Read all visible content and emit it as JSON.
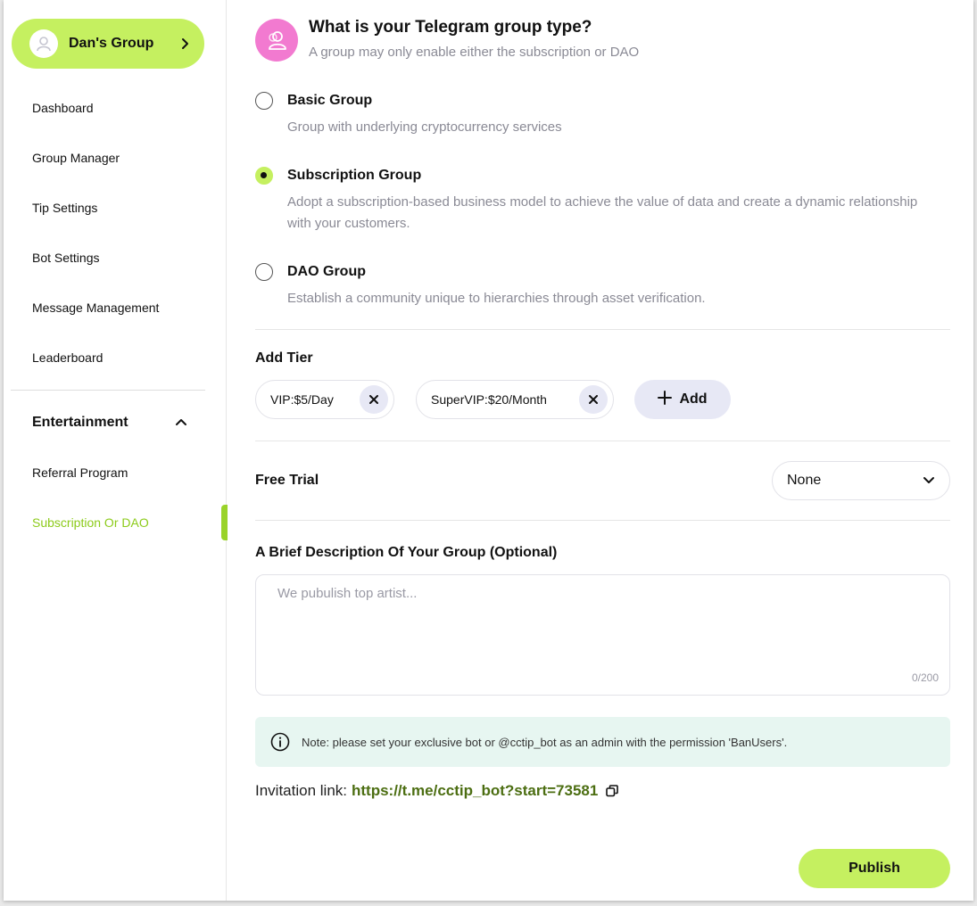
{
  "sidebar": {
    "group_name": "Dan's Group",
    "items": [
      {
        "label": "Dashboard"
      },
      {
        "label": "Group Manager"
      },
      {
        "label": "Tip Settings"
      },
      {
        "label": "Bot Settings"
      },
      {
        "label": "Message Management"
      },
      {
        "label": "Leaderboard"
      }
    ],
    "section": {
      "label": "Entertainment",
      "expanded": true,
      "items": [
        {
          "label": "Referral Program",
          "active": false
        },
        {
          "label": "Subscription Or DAO",
          "active": true
        }
      ]
    }
  },
  "main": {
    "title": "What is your Telegram group type?",
    "subtitle": "A group may only enable either the subscription or DAO",
    "options": [
      {
        "title": "Basic Group",
        "desc": "Group with underlying cryptocurrency services",
        "checked": false
      },
      {
        "title": "Subscription Group",
        "desc": "Adopt a subscription-based business model to achieve the value of data and create a dynamic relationship with your customers.",
        "checked": true
      },
      {
        "title": "DAO Group",
        "desc": "Establish a community unique to hierarchies through asset verification.",
        "checked": false
      }
    ],
    "tier": {
      "label": "Add Tier",
      "chips": [
        "VIP:$5/Day",
        "SuperVIP:$20/Month"
      ],
      "add_label": "Add"
    },
    "free_trial": {
      "label": "Free Trial",
      "value": "None"
    },
    "description": {
      "label": "A Brief Description Of Your Group (Optional)",
      "placeholder": "We pubulish top artist...",
      "counter": "0/200"
    },
    "note": "Note: please set your exclusive bot or @cctip_bot as an admin with the permission 'BanUsers'.",
    "invite": {
      "label": "Invitation link:",
      "url": "https://t.me/cctip_bot?start=73581"
    },
    "publish_label": "Publish"
  },
  "colors": {
    "accent": "#c5f060",
    "active_text": "#8ccb1a",
    "link": "#4c6e12",
    "header_icon": "#f27ad0",
    "note_bg": "#e7f6f1"
  }
}
